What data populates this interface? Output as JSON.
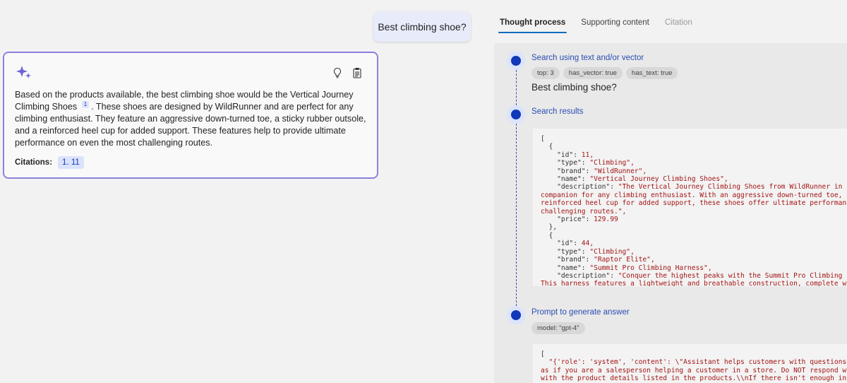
{
  "chat": {
    "user_question": "Best climbing shoe?",
    "answer": {
      "text_before": "Based on the products available, the best climbing shoe would be the Vertical Journey Climbing Shoes",
      "citation_marker": "1",
      "text_after": ". These shoes are designed by WildRunner and are perfect for any climbing enthusiast. They feature an aggressive down-turned toe, a sticky rubber outsole, and a reinforced heel cup for added support. These features help to provide ultimate performance on even the most challenging routes.",
      "citations_label": "Citations:",
      "citations": [
        "1. 11"
      ],
      "icons": [
        "sparkle-icon",
        "lightbulb-icon",
        "clipboard-icon"
      ]
    }
  },
  "panel": {
    "tabs": [
      {
        "label": "Thought process",
        "state": "active"
      },
      {
        "label": "Supporting content",
        "state": "normal"
      },
      {
        "label": "Citation",
        "state": "disabled"
      }
    ],
    "steps": [
      {
        "title": "Search using text and/or vector",
        "chips": [
          "top: 3",
          "has_vector: true",
          "has_text: true"
        ],
        "query": "Best climbing shoe?"
      },
      {
        "title": "Search results",
        "code": [
          "[",
          "  {",
          "    \"id\": 11,",
          "    \"type\": \"Climbing\",",
          "    \"brand\": \"WildRunner\",",
          "    \"name\": \"Vertical Journey Climbing Shoes\",",
          "    \"description\": \"The Vertical Journey Climbing Shoes from WildRunner in",
          "companion for any climbing enthusiast. With an aggressive down-turned toe,",
          "reinforced heel cup for added support, these shoes offer ultimate performan",
          "challenging routes.\",",
          "    \"price\": 129.99",
          "  },",
          "  {",
          "    \"id\": 44,",
          "    \"type\": \"Climbing\",",
          "    \"brand\": \"Raptor Elite\",",
          "    \"name\": \"Summit Pro Climbing Harness\",",
          "    \"description\": \"Conquer the highest peaks with the Summit Pro Climbing",
          "This harness features a lightweight and breathable construction, complete w"
        ]
      },
      {
        "title": "Prompt to generate answer",
        "chips": [
          "model: \"gpt-4\""
        ],
        "code": [
          "[",
          "  \"{'role': 'system', 'content': \\\"Assistant helps customers with questions",
          "as if you are a salesperson helping a customer in a store. Do NOT respond w",
          "with the product details listed in the products.\\\\nIf there isn't enough in"
        ]
      }
    ]
  },
  "colors": {
    "accent": "#1038b8",
    "card_border": "#8a82d9",
    "code_value": "#a31515",
    "tab_underline": "#0f6cbd"
  }
}
